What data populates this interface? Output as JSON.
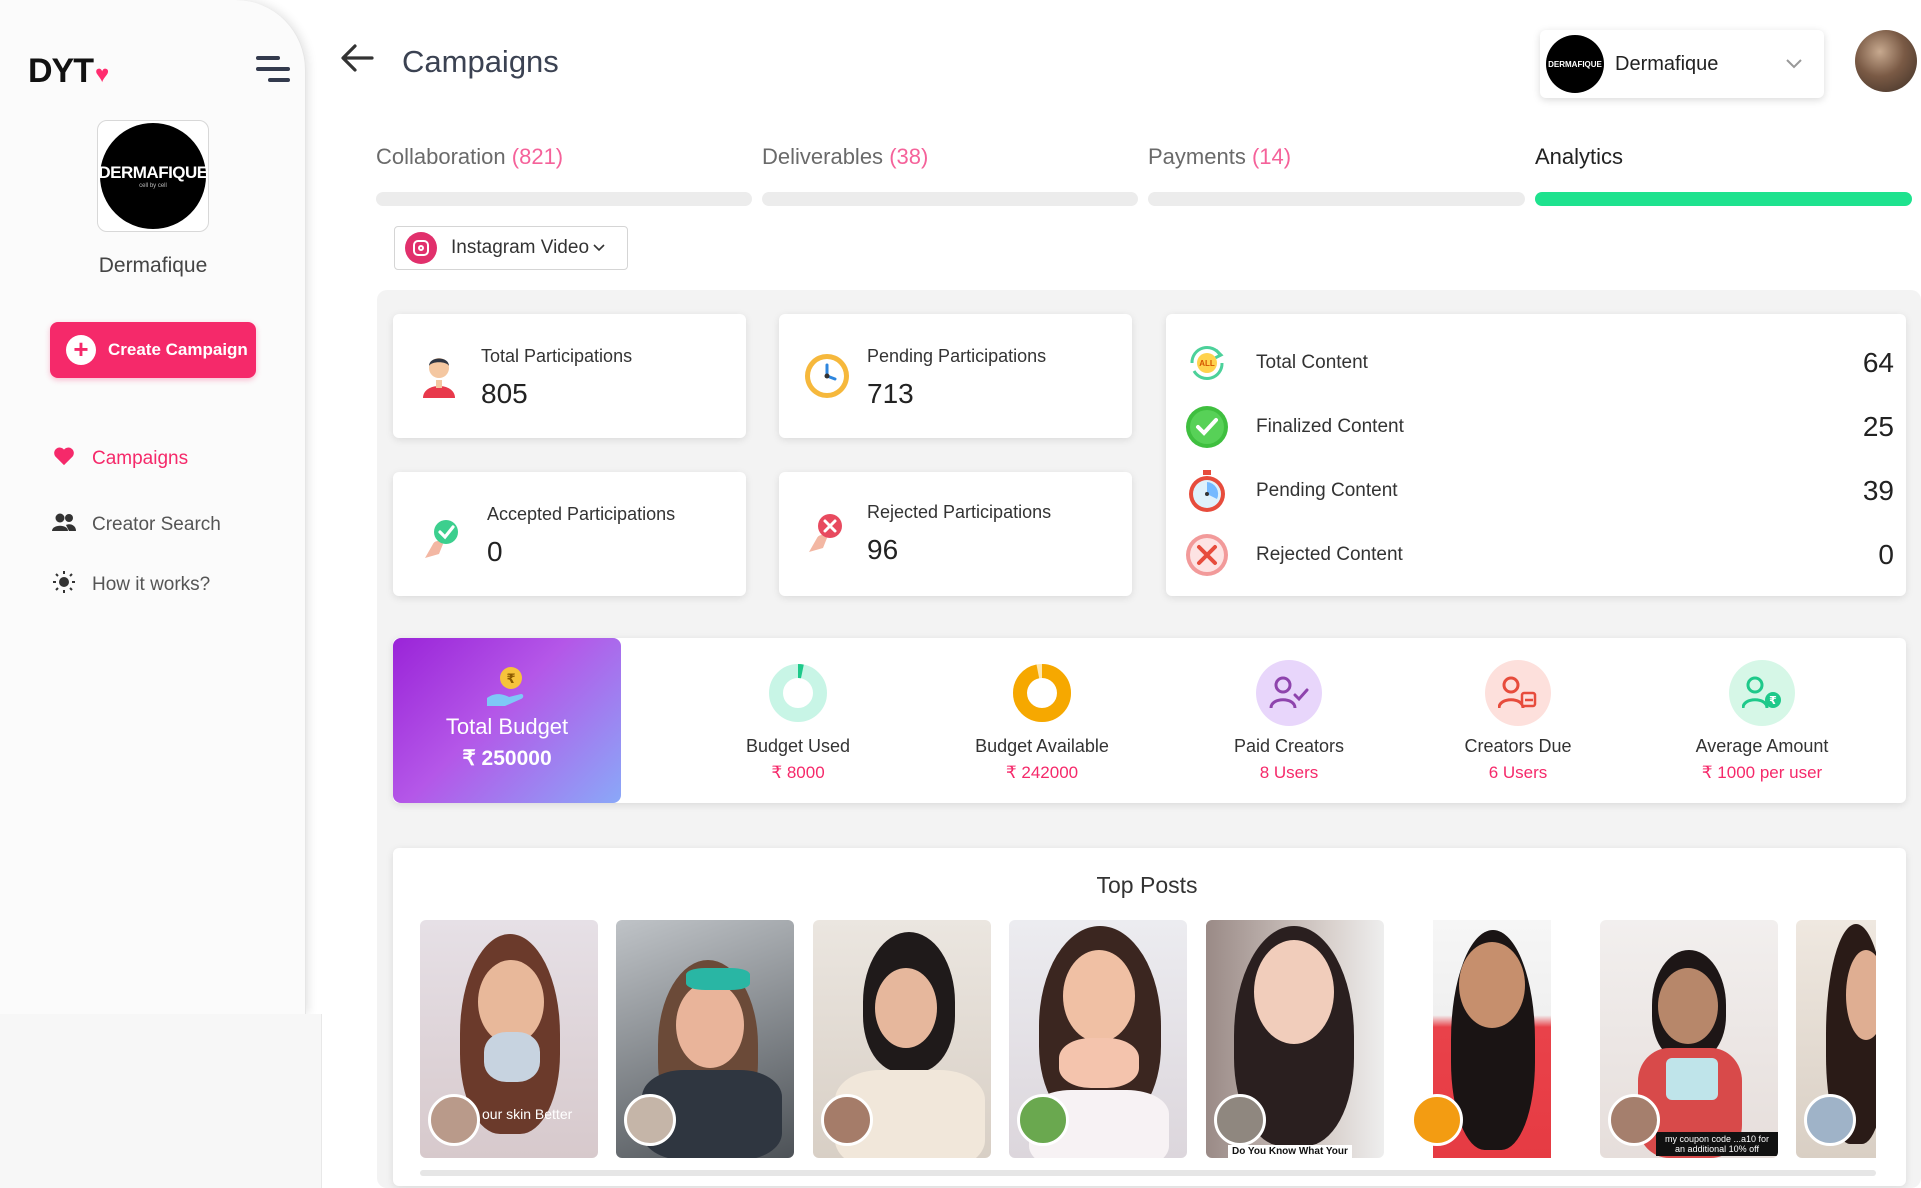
{
  "sidebar": {
    "logo_text": "DYT",
    "logo_heart": "♥",
    "brand_logo_text": "DERMAFIQUE",
    "brand_logo_tagline": "cell by cell",
    "brand_name": "Dermafique",
    "create_button": "Create Campaign",
    "nav": [
      {
        "label": "Campaigns",
        "icon": "heart-icon",
        "active": true
      },
      {
        "label": "Creator Search",
        "icon": "users-icon",
        "active": false
      },
      {
        "label": "How it works?",
        "icon": "bulb-icon",
        "active": false
      }
    ]
  },
  "header": {
    "title": "Campaigns",
    "brand_select": "Dermafique",
    "brand_select_logo": "DERMAFIQUE"
  },
  "tabs": [
    {
      "label": "Collaboration",
      "count": "(821)",
      "active": false
    },
    {
      "label": "Deliverables",
      "count": "(38)",
      "active": false
    },
    {
      "label": "Payments",
      "count": "(14)",
      "active": false
    },
    {
      "label": "Analytics",
      "count": "",
      "active": true
    }
  ],
  "platform_select": {
    "value": "Instagram Video"
  },
  "participation_stats": [
    {
      "label": "Total Participations",
      "value": "805",
      "icon": "person-icon"
    },
    {
      "label": "Pending Participations",
      "value": "713",
      "icon": "clock-icon"
    },
    {
      "label": "Accepted Participations",
      "value": "0",
      "icon": "accepted-hand-icon"
    },
    {
      "label": "Rejected Participations",
      "value": "96",
      "icon": "rejected-hand-icon"
    }
  ],
  "content_stats": [
    {
      "label": "Total Content",
      "value": "64",
      "icon": "all-cycle-icon"
    },
    {
      "label": "Finalized Content",
      "value": "25",
      "icon": "check-circle-icon"
    },
    {
      "label": "Pending Content",
      "value": "39",
      "icon": "stopwatch-icon"
    },
    {
      "label": "Rejected Content",
      "value": "0",
      "icon": "x-circle-icon"
    }
  ],
  "budget": {
    "label": "Total Budget",
    "value": "₹ 250000"
  },
  "budget_metrics": [
    {
      "label": "Budget Used",
      "value": "₹ 8000",
      "icon": "donut-used-icon",
      "fraction": 0.032
    },
    {
      "label": "Budget Available",
      "value": "₹ 242000",
      "icon": "donut-available-icon",
      "fraction": 0.968
    },
    {
      "label": "Paid Creators",
      "value": "8 Users",
      "icon": "user-check-icon"
    },
    {
      "label": "Creators Due",
      "value": "6 Users",
      "icon": "users-due-icon"
    },
    {
      "label": "Average Amount",
      "value": "₹ 1000 per user",
      "icon": "user-rupee-icon"
    }
  ],
  "top_posts": {
    "title": "Top Posts",
    "posts": [
      {
        "caption": "our skin Better"
      },
      {
        "caption": ""
      },
      {
        "caption": ""
      },
      {
        "caption": ""
      },
      {
        "caption": "Do You Know What Your"
      },
      {
        "caption": ""
      },
      {
        "caption": "my coupon code ...a10 for an additional 10% off"
      },
      {
        "caption": ""
      }
    ]
  },
  "colors": {
    "accent": "#f5296a",
    "tab_active": "#1ee28e",
    "tab_count": "#f5629a"
  }
}
